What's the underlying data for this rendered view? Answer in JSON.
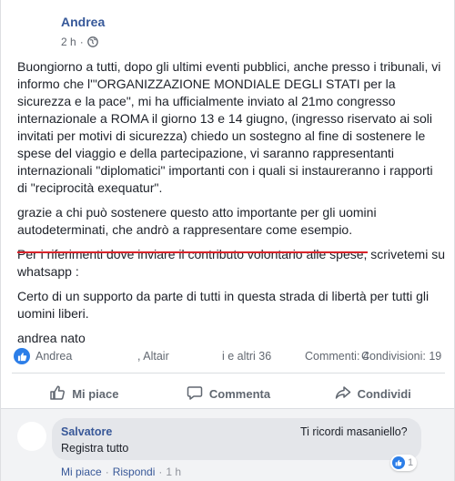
{
  "post": {
    "author": "Andrea",
    "time": "2 h",
    "separator": "·",
    "paragraphs": [
      "Buongiorno a tutti, dopo gli ultimi eventi pubblici, anche presso i tribunali, vi informo che l'\"ORGANIZZAZIONE MONDIALE DEGLI STATI per la sicurezza e la pace\", mi ha ufficialmente inviato al 21mo congresso internazionale a ROMA il giorno 13 e 14 giugno, (ingresso riservato ai soli invitati per motivi di sicurezza) chiedo un sostegno al fine di sostenere le spese del viaggio e della partecipazione, vi saranno rappresentanti internazionali \"diplomatici\" importanti con i quali si instaureranno i rapporti di \"reciprocità exequatur\".",
      "grazie a chi può sostenere questo atto importante per gli uomini autodeterminati, che andrò a rappresentare come esempio.",
      "Per i riferimenti dove inviare il contributo volontario alle spese, scrivetemi su whatsapp :",
      "Certo di un supporto da parte di tutti in questa strada di libertà per tutti gli uomini liberi.",
      "andrea nato"
    ]
  },
  "stats": {
    "reactor_1": "Andrea",
    "reactor_2": ", Altair",
    "others": "i e altri 36",
    "comments": "Commenti: 4",
    "shares": "Condivisioni: 19"
  },
  "actions": {
    "like": "Mi piace",
    "comment": "Commenta",
    "share": "Condividi"
  },
  "comment": {
    "author": "Salvatore",
    "text_right": "Ti ricordi masaniello?",
    "text": "Registra tutto",
    "reaction_count": "1",
    "like_label": "Mi piace",
    "reply_label": "Rispondi",
    "time": "1 h",
    "sep": "·"
  },
  "colors": {
    "brand_blue": "#365899",
    "like_blue": "#2c7ee8",
    "underline_red": "#d8232a"
  },
  "icons": [
    "globe-icon",
    "like-reaction-icon",
    "thumbs-up-icon",
    "comment-icon",
    "share-icon"
  ]
}
